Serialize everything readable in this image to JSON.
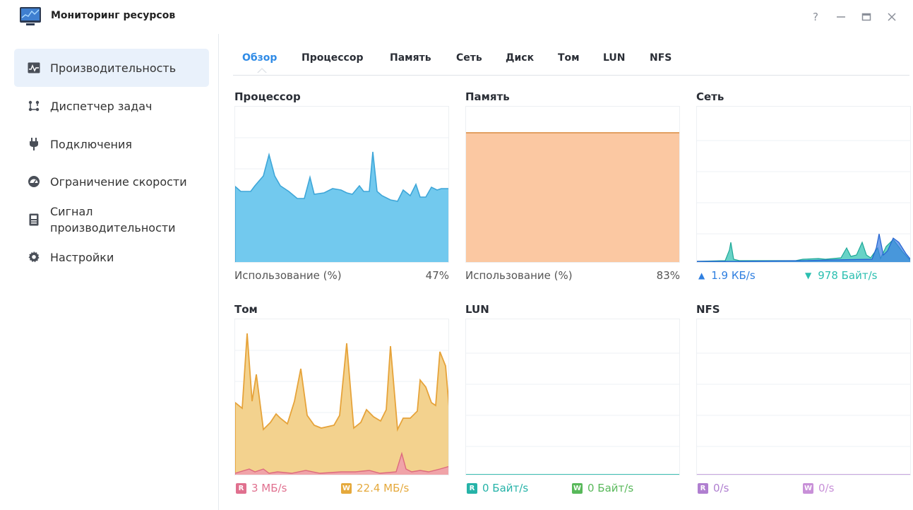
{
  "app": {
    "title": "Мониторинг ресурсов"
  },
  "window_controls": {
    "help": "?",
    "minimize": "—",
    "maximize": "🗖",
    "close": "✕"
  },
  "sidebar": {
    "items": [
      {
        "label": "Производительность",
        "icon": "performance-icon",
        "active": true
      },
      {
        "label": "Диспетчер задач",
        "icon": "task-manager-icon"
      },
      {
        "label": "Подключения",
        "icon": "plug-icon"
      },
      {
        "label": "Ограничение скорости",
        "icon": "speed-limit-icon"
      },
      {
        "label": "Сигнал производительности",
        "icon": "performance-alert-icon"
      },
      {
        "label": "Настройки",
        "icon": "gear-icon"
      }
    ]
  },
  "tabs": [
    "Обзор",
    "Процессор",
    "Память",
    "Сеть",
    "Диск",
    "Том",
    "LUN",
    "NFS"
  ],
  "active_tab": "Обзор",
  "panels": {
    "cpu": {
      "title": "Процессор",
      "usage_label": "Использование (%)",
      "usage_value": "47%",
      "color": "#6cc8ee",
      "stroke": "#3aa3d6"
    },
    "memory": {
      "title": "Память",
      "usage_label": "Использование (%)",
      "usage_value": "83%",
      "color": "#fbc8a2",
      "stroke": "#e5a463",
      "level": 83
    },
    "network": {
      "title": "Сеть",
      "upload": "1.9 КБ/s",
      "download": "978 Байт/s",
      "upload_color": "#2f7fe0",
      "download_color": "#2bbfb0"
    },
    "volume": {
      "title": "Том",
      "read_badge": "R",
      "read": "3 МБ/s",
      "write_badge": "W",
      "write": "22.4 МБ/s",
      "read_color": "#e0708f",
      "write_color": "#e5a93c"
    },
    "lun": {
      "title": "LUN",
      "read_badge": "R",
      "read": "0 Байт/s",
      "write_badge": "W",
      "write": "0 Байт/s",
      "read_color": "#26b3a8",
      "write_color": "#58b85a"
    },
    "nfs": {
      "title": "NFS",
      "read_badge": "R",
      "read": "0/s",
      "write_badge": "W",
      "write": "0/s",
      "read_color": "#b07fd0",
      "write_color": "#c890d8"
    }
  }
}
